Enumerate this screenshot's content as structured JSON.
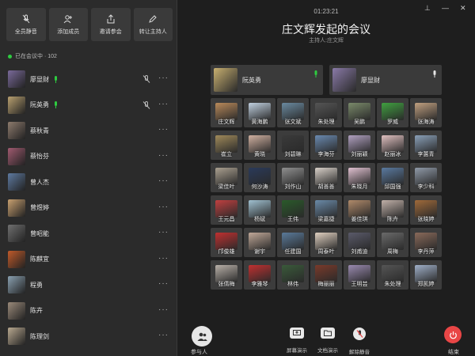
{
  "toolbar": {
    "mute_all": "全员静音",
    "add_member": "添加成员",
    "invite": "邀请参会",
    "transfer_host": "转让主持人"
  },
  "status": "已在会议中 · 102",
  "participants": [
    {
      "name": "廖显财",
      "talking": true,
      "muted": true,
      "color": "#7a6a9a"
    },
    {
      "name": "阮英勇",
      "talking": true,
      "muted": true,
      "color": "#b8a070"
    },
    {
      "name": "蔡秋青",
      "talking": false,
      "muted": false,
      "color": "#8d7b6d"
    },
    {
      "name": "蔡怡芬",
      "talking": false,
      "muted": false,
      "color": "#a05a70"
    },
    {
      "name": "曾人杰",
      "talking": false,
      "muted": false,
      "color": "#5e7aa0"
    },
    {
      "name": "曾煜婷",
      "talking": false,
      "muted": false,
      "color": "#c8a070"
    },
    {
      "name": "曾昭能",
      "talking": false,
      "muted": false,
      "color": "#707070"
    },
    {
      "name": "陈麒宜",
      "talking": false,
      "muted": false,
      "color": "#c05a2a"
    },
    {
      "name": "程勇",
      "talking": false,
      "muted": false,
      "color": "#8aa0b0"
    },
    {
      "name": "陈卉",
      "talking": false,
      "muted": false,
      "color": "#9a8a7a"
    },
    {
      "name": "陈理剑",
      "talking": false,
      "muted": false,
      "color": "#b8a890"
    }
  ],
  "participants_label": "参与人",
  "timer": "01:23:21",
  "meeting": {
    "title": "庄文辉发起的会议",
    "host": "主持人:庄文辉"
  },
  "speakers": [
    {
      "name": "阮英勇",
      "color": "#c8b070",
      "mic": "#2ecc40"
    },
    {
      "name": "廖显财",
      "color": "#8a7aa8",
      "mic": "#e6e6e6"
    }
  ],
  "grid": [
    {
      "name": "庄文辉",
      "color": "#b98a5a"
    },
    {
      "name": "黄海鹏",
      "color": "#c0d0e0"
    },
    {
      "name": "张文斌",
      "color": "#6a8aa0"
    },
    {
      "name": "朱处理",
      "color": "#555555"
    },
    {
      "name": "吴鹏",
      "color": "#7a8a6a"
    },
    {
      "name": "罗威",
      "color": "#40a040"
    },
    {
      "name": "张海涛",
      "color": "#c0a080"
    },
    {
      "name": "崔立",
      "color": "#a08a5a"
    },
    {
      "name": "黄晓",
      "color": "#d0b0a0"
    },
    {
      "name": "刘碧琳",
      "color": "#3a3a3a"
    },
    {
      "name": "李海芬",
      "color": "#6a8ab0"
    },
    {
      "name": "刘丽颖",
      "color": "#b0a0c0"
    },
    {
      "name": "赵丽冰",
      "color": "#e0c0c0"
    },
    {
      "name": "李蕙青",
      "color": "#8aa0b8"
    },
    {
      "name": "梁佳叶",
      "color": "#aaa090"
    },
    {
      "name": "何沙涛",
      "color": "#2a3a5a"
    },
    {
      "name": "刘作山",
      "color": "#909090"
    },
    {
      "name": "胡善善",
      "color": "#d8d0c8"
    },
    {
      "name": "朱晓月",
      "color": "#e0c0d0"
    },
    {
      "name": "邱国强",
      "color": "#5a7aa0"
    },
    {
      "name": "李少科",
      "color": "#909aa8"
    },
    {
      "name": "王元昌",
      "color": "#c04040"
    },
    {
      "name": "杨斌",
      "color": "#a0c0d0"
    },
    {
      "name": "王伟",
      "color": "#2a5a2a"
    },
    {
      "name": "梁嘉捷",
      "color": "#6a8aa8"
    },
    {
      "name": "姜佳琪",
      "color": "#b08a6a"
    },
    {
      "name": "陈卉",
      "color": "#c0b0a8"
    },
    {
      "name": "张晓婷",
      "color": "#a06a3a"
    },
    {
      "name": "邝俊雄",
      "color": "#c03030"
    },
    {
      "name": "谢宇",
      "color": "#c0a898"
    },
    {
      "name": "任建国",
      "color": "#5a7a9a"
    },
    {
      "name": "周泰叶",
      "color": "#e0d0c0"
    },
    {
      "name": "刘甫迪",
      "color": "#5a5a6a"
    },
    {
      "name": "周梅",
      "color": "#6a6a6a"
    },
    {
      "name": "李丹萍",
      "color": "#8a6a5a"
    },
    {
      "name": "张倩梅",
      "color": "#b8b0a8"
    },
    {
      "name": "李雅琴",
      "color": "#c03030"
    },
    {
      "name": "林伟",
      "color": "#3a5a3a"
    },
    {
      "name": "梅丽丽",
      "color": "#7a3a2a"
    },
    {
      "name": "王明芸",
      "color": "#9a8ab0"
    },
    {
      "name": "朱处理",
      "color": "#555555"
    },
    {
      "name": "郑凯婷",
      "color": "#a0b0c8"
    }
  ],
  "controls": {
    "screen_share": "屏幕演示",
    "doc_share": "文档演示",
    "unmute": "解除静音",
    "end": "结束"
  },
  "colors": {
    "background": "#1e1e1e",
    "sidebar": "#2b2b2b",
    "talking": "#2ecc40",
    "end": "#e94646"
  }
}
